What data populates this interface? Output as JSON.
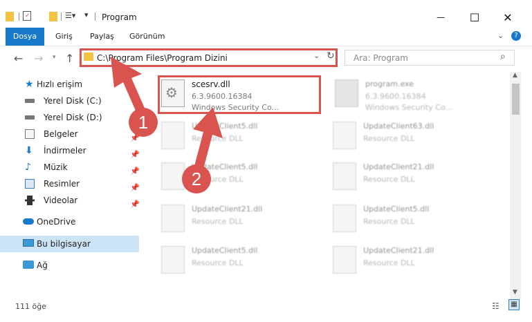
{
  "window": {
    "title": "Program",
    "minimize": "—",
    "maximize": "☐",
    "close": "✕"
  },
  "ribbon": {
    "tabs": [
      "Dosya",
      "Giriş",
      "Paylaş",
      "Görünüm"
    ]
  },
  "address": {
    "path": "C:\\Program Files\\Program Dizini"
  },
  "search": {
    "placeholder": "Ara: Program"
  },
  "sidebar": [
    {
      "label": "Hızlı erişim",
      "icon": "star-icon"
    },
    {
      "label": "Yerel Disk (C:)",
      "icon": "drive-icon"
    },
    {
      "label": "Yerel Disk (D:)",
      "icon": "drive-icon"
    },
    {
      "label": "Belgeler",
      "icon": "documents-icon"
    },
    {
      "label": "İndirmeler",
      "icon": "download-icon"
    },
    {
      "label": "Müzik",
      "icon": "music-icon"
    },
    {
      "label": "Resimler",
      "icon": "pictures-icon"
    },
    {
      "label": "Videolar",
      "icon": "video-icon"
    },
    {
      "label": "OneDrive",
      "icon": "cloud-icon"
    },
    {
      "label": "Bu bilgisayar",
      "icon": "computer-icon"
    },
    {
      "label": "Ağ",
      "icon": "network-icon"
    }
  ],
  "files": [
    {
      "name": "scesrv.dll",
      "version": "6.3.9600.16384",
      "desc": "Windows Security Co..."
    },
    {
      "name": "program.exe",
      "version": "6.3.9600.16384",
      "desc": "Windows Security Co..."
    },
    {
      "name": "UpdateClient5.dll",
      "desc": "Resource DLL"
    },
    {
      "name": "UpdateClient63.dll",
      "desc": "Resource DLL"
    },
    {
      "name": "UpdateClient5.dll",
      "desc": "Resource DLL"
    },
    {
      "name": "UpdateClient21.dll",
      "desc": "Resource DLL"
    },
    {
      "name": "UpdateClient21.dll",
      "desc": "Resource DLL"
    },
    {
      "name": "UpdateClient5.dll",
      "desc": "Resource DLL"
    },
    {
      "name": "UpdateClient5.dll",
      "desc": "Resource DLL"
    },
    {
      "name": "UpdateClient21.dll",
      "desc": "Resource DLL"
    }
  ],
  "status": {
    "count": "111 öğe"
  },
  "annotations": {
    "badge1": "1",
    "badge2": "2"
  },
  "colors": {
    "accent": "#1979ca",
    "highlight": "#d9534f",
    "selected": "#cce4f7"
  }
}
